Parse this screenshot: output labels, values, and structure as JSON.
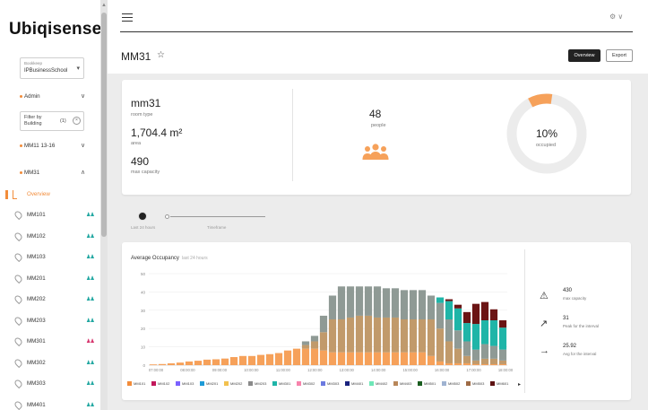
{
  "sidebar": {
    "logo": "Ubiqisense",
    "building_select": {
      "caption": "Bookkeep",
      "value": "IPBusinessSchool"
    },
    "admin_label": "Admin",
    "filter": {
      "label": "Filter by Building",
      "count": "(1)"
    },
    "group_label": "MM11 13-16",
    "floor_label": "MM31",
    "overview_label": "Overview",
    "rooms": [
      {
        "label": "MM101",
        "people_color": "#1fa6a0"
      },
      {
        "label": "MM102",
        "people_color": "#1fa6a0"
      },
      {
        "label": "MM103",
        "people_color": "#1fa6a0"
      },
      {
        "label": "MM201",
        "people_color": "#1fa6a0"
      },
      {
        "label": "MM202",
        "people_color": "#1fa6a0"
      },
      {
        "label": "MM203",
        "people_color": "#1fa6a0"
      },
      {
        "label": "MM301",
        "people_color": "#d6336c"
      },
      {
        "label": "MM302",
        "people_color": "#1fa6a0"
      },
      {
        "label": "MM303",
        "people_color": "#1fa6a0"
      },
      {
        "label": "MM401",
        "people_color": "#1fa6a0"
      }
    ]
  },
  "header": {
    "user_menu": "⚙ ∨",
    "page_title": "MM31",
    "star_icon": "star-icon",
    "overview_button": "Overview",
    "export_button": "Export"
  },
  "info": {
    "room_name": "mm31",
    "room_type_label": "room type",
    "area": "1,704.4 m²",
    "area_label": "area",
    "capacity": "490",
    "capacity_label": "max capacity",
    "people": "48",
    "people_label": "people",
    "occupied_pct": "10%",
    "occupied_label": "occupied",
    "occupied_fraction": 0.1,
    "accent": "#f6a15a"
  },
  "toggles": {
    "left_label": "Last 24 hours",
    "right_label": "Timeframe"
  },
  "chart": {
    "title": "Average Occupancy",
    "subtitle": "last 24 hours",
    "kpis": [
      {
        "icon": "warning-icon",
        "value": "430",
        "label": "max capacity"
      },
      {
        "icon": "trend-up-icon",
        "value": "31",
        "label": "Peak for the interval"
      },
      {
        "icon": "arrow-right-icon",
        "value": "25.92",
        "label": "Avg for the interval"
      }
    ],
    "legend_more": "▸"
  },
  "chart_data": {
    "type": "bar",
    "stacked": true,
    "title": "Average Occupancy",
    "ylim": [
      0,
      50
    ],
    "yticks": [
      0,
      10,
      20,
      30,
      40,
      50
    ],
    "xticklabels": [
      "07:00:00",
      "08:00:00",
      "09:00:00",
      "10:00:00",
      "11:00:00",
      "12:00:00",
      "13:00:00",
      "14:00:00",
      "15:00:00",
      "16:00:00",
      "17:00:00",
      "18:00:00"
    ],
    "series": [
      {
        "name": "MM101",
        "color": "#f28c3a"
      },
      {
        "name": "MM102",
        "color": "#c2185b"
      },
      {
        "name": "MM103",
        "color": "#7b61ff"
      },
      {
        "name": "MM201",
        "color": "#1e9bd7"
      },
      {
        "name": "MM202",
        "color": "#f2c14e"
      },
      {
        "name": "MM203",
        "color": "#8a8a8a"
      },
      {
        "name": "MM301",
        "color": "#1fb5a8"
      },
      {
        "name": "MM302",
        "color": "#f783ac"
      },
      {
        "name": "MM303",
        "color": "#6c7ae0"
      },
      {
        "name": "MM401",
        "color": "#1a237e"
      },
      {
        "name": "MM402",
        "color": "#6ee7b7"
      },
      {
        "name": "MM403",
        "color": "#b8875a"
      },
      {
        "name": "MM501",
        "color": "#1b5e20"
      },
      {
        "name": "MM502",
        "color": "#9fb3d1"
      },
      {
        "name": "MM503",
        "color": "#9e6b45"
      },
      {
        "name": "MM601",
        "color": "#5d1212"
      }
    ],
    "bars": [
      {
        "orange": 0.4,
        "tan": 0,
        "gray": 0,
        "teal": 0,
        "maroon": 0
      },
      {
        "orange": 0.6,
        "tan": 0,
        "gray": 0,
        "teal": 0,
        "maroon": 0
      },
      {
        "orange": 1.0,
        "tan": 0,
        "gray": 0,
        "teal": 0,
        "maroon": 0
      },
      {
        "orange": 1.4,
        "tan": 0,
        "gray": 0,
        "teal": 0,
        "maroon": 0
      },
      {
        "orange": 2.0,
        "tan": 0,
        "gray": 0,
        "teal": 0,
        "maroon": 0
      },
      {
        "orange": 2.4,
        "tan": 0,
        "gray": 0,
        "teal": 0,
        "maroon": 0
      },
      {
        "orange": 3.0,
        "tan": 0,
        "gray": 0,
        "teal": 0,
        "maroon": 0
      },
      {
        "orange": 3.2,
        "tan": 0,
        "gray": 0,
        "teal": 0,
        "maroon": 0
      },
      {
        "orange": 3.6,
        "tan": 0,
        "gray": 0,
        "teal": 0,
        "maroon": 0
      },
      {
        "orange": 4.4,
        "tan": 0,
        "gray": 0,
        "teal": 0,
        "maroon": 0
      },
      {
        "orange": 5.0,
        "tan": 0,
        "gray": 0,
        "teal": 0,
        "maroon": 0
      },
      {
        "orange": 5.0,
        "tan": 0,
        "gray": 0,
        "teal": 0,
        "maroon": 0
      },
      {
        "orange": 5.6,
        "tan": 0,
        "gray": 0,
        "teal": 0,
        "maroon": 0
      },
      {
        "orange": 6.0,
        "tan": 0,
        "gray": 0,
        "teal": 0,
        "maroon": 0
      },
      {
        "orange": 6.6,
        "tan": 0,
        "gray": 0,
        "teal": 0,
        "maroon": 0
      },
      {
        "orange": 8.0,
        "tan": 0,
        "gray": 0,
        "teal": 0,
        "maroon": 0
      },
      {
        "orange": 9.0,
        "tan": 0,
        "gray": 0,
        "teal": 0,
        "maroon": 0
      },
      {
        "orange": 9.0,
        "tan": 2.0,
        "gray": 2.0,
        "teal": 0,
        "maroon": 0
      },
      {
        "orange": 9.0,
        "tan": 4.0,
        "gray": 3.0,
        "teal": 0,
        "maroon": 0
      },
      {
        "orange": 8.0,
        "tan": 10.0,
        "gray": 9.0,
        "teal": 0,
        "maroon": 0
      },
      {
        "orange": 7.0,
        "tan": 18.0,
        "gray": 13.0,
        "teal": 0,
        "maroon": 0
      },
      {
        "orange": 7.0,
        "tan": 18.0,
        "gray": 18.0,
        "teal": 0,
        "maroon": 0
      },
      {
        "orange": 7.0,
        "tan": 19.0,
        "gray": 17.0,
        "teal": 0,
        "maroon": 0
      },
      {
        "orange": 7.0,
        "tan": 20.0,
        "gray": 16.0,
        "teal": 0,
        "maroon": 0
      },
      {
        "orange": 7.0,
        "tan": 20.0,
        "gray": 16.0,
        "teal": 0,
        "maroon": 0
      },
      {
        "orange": 7.0,
        "tan": 19.0,
        "gray": 17.0,
        "teal": 0,
        "maroon": 0
      },
      {
        "orange": 7.0,
        "tan": 19.0,
        "gray": 16.0,
        "teal": 0,
        "maroon": 0
      },
      {
        "orange": 7.0,
        "tan": 19.0,
        "gray": 16.0,
        "teal": 0,
        "maroon": 0
      },
      {
        "orange": 7.0,
        "tan": 18.0,
        "gray": 16.0,
        "teal": 0,
        "maroon": 0
      },
      {
        "orange": 7.0,
        "tan": 18.0,
        "gray": 16.0,
        "teal": 0,
        "maroon": 0
      },
      {
        "orange": 7.0,
        "tan": 18.0,
        "gray": 16.0,
        "teal": 0,
        "maroon": 0
      },
      {
        "orange": 5.0,
        "tan": 20.0,
        "gray": 13.0,
        "teal": 0,
        "maroon": 0
      },
      {
        "orange": 2.0,
        "tan": 18.0,
        "gray": 14.0,
        "teal": 3.0,
        "maroon": 0
      },
      {
        "orange": 1.0,
        "tan": 12.0,
        "gray": 12.0,
        "teal": 10.0,
        "maroon": 1.0
      },
      {
        "orange": 1.0,
        "tan": 8.0,
        "gray": 10.0,
        "teal": 12.0,
        "maroon": 2.0
      },
      {
        "orange": 1.0,
        "tan": 4.0,
        "gray": 8.0,
        "teal": 10.0,
        "maroon": 6.0
      },
      {
        "orange": 0.5,
        "tan": 2.0,
        "gray": 6.0,
        "teal": 14.0,
        "maroon": 11.0
      },
      {
        "orange": 0.5,
        "tan": 3.0,
        "gray": 8.0,
        "teal": 13.0,
        "maroon": 10.0
      },
      {
        "orange": 0.5,
        "tan": 3.0,
        "gray": 7.0,
        "teal": 14.0,
        "maroon": 6.0
      },
      {
        "orange": 0.5,
        "tan": 2.0,
        "gray": 6.0,
        "teal": 12.0,
        "maroon": 4.0
      }
    ],
    "stack_colors": {
      "orange": "#f6a15a",
      "tan": "#c19a6b",
      "gray": "#8f9a95",
      "teal": "#1fb5a8",
      "maroon": "#6b1414"
    }
  }
}
